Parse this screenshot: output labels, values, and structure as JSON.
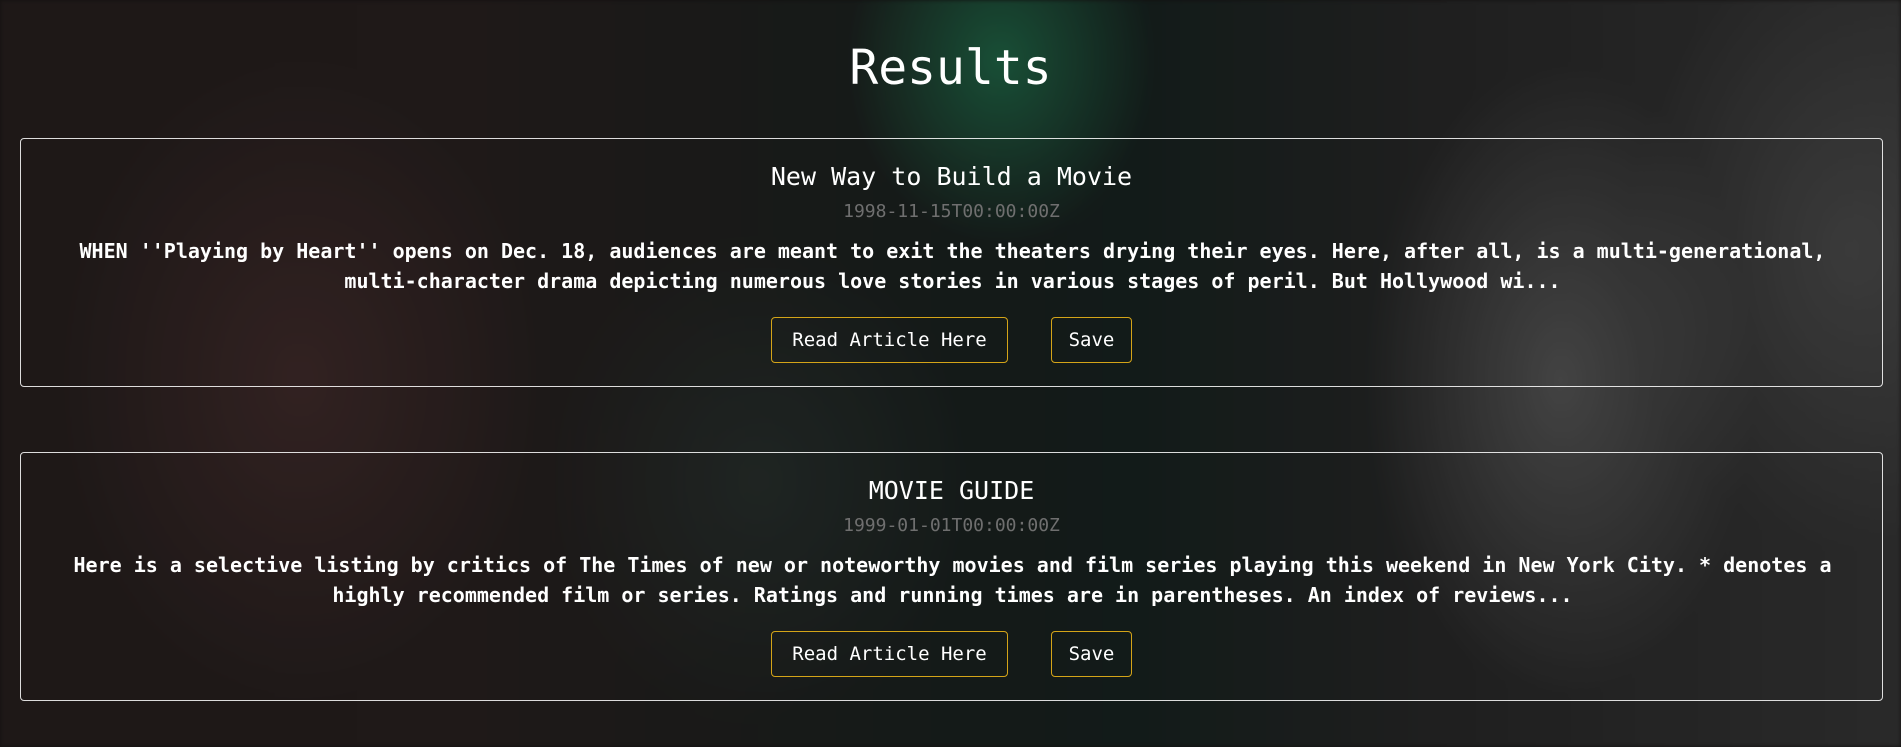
{
  "page": {
    "title": "Results"
  },
  "colors": {
    "button_border": "#d4a418",
    "date_text": "#6f6f6f",
    "card_border": "#ffffff"
  },
  "results": [
    {
      "title": "New Way to Build a Movie",
      "date": "1998-11-15T00:00:00Z",
      "snippet": "WHEN ''Playing by Heart'' opens on Dec. 18, audiences are meant to exit the theaters drying their eyes. Here, after all, is a multi-generational, multi-character drama depicting numerous love stories in various stages of peril. But Hollywood wi...",
      "read_label": "Read Article Here",
      "save_label": "Save"
    },
    {
      "title": "MOVIE GUIDE",
      "date": "1999-01-01T00:00:00Z",
      "snippet": "Here is a selective listing by critics of The Times of new or noteworthy movies and film series playing this weekend in New York City. * denotes a highly recommended film or series. Ratings and running times are in parentheses. An index of reviews...",
      "read_label": "Read Article Here",
      "save_label": "Save"
    }
  ]
}
